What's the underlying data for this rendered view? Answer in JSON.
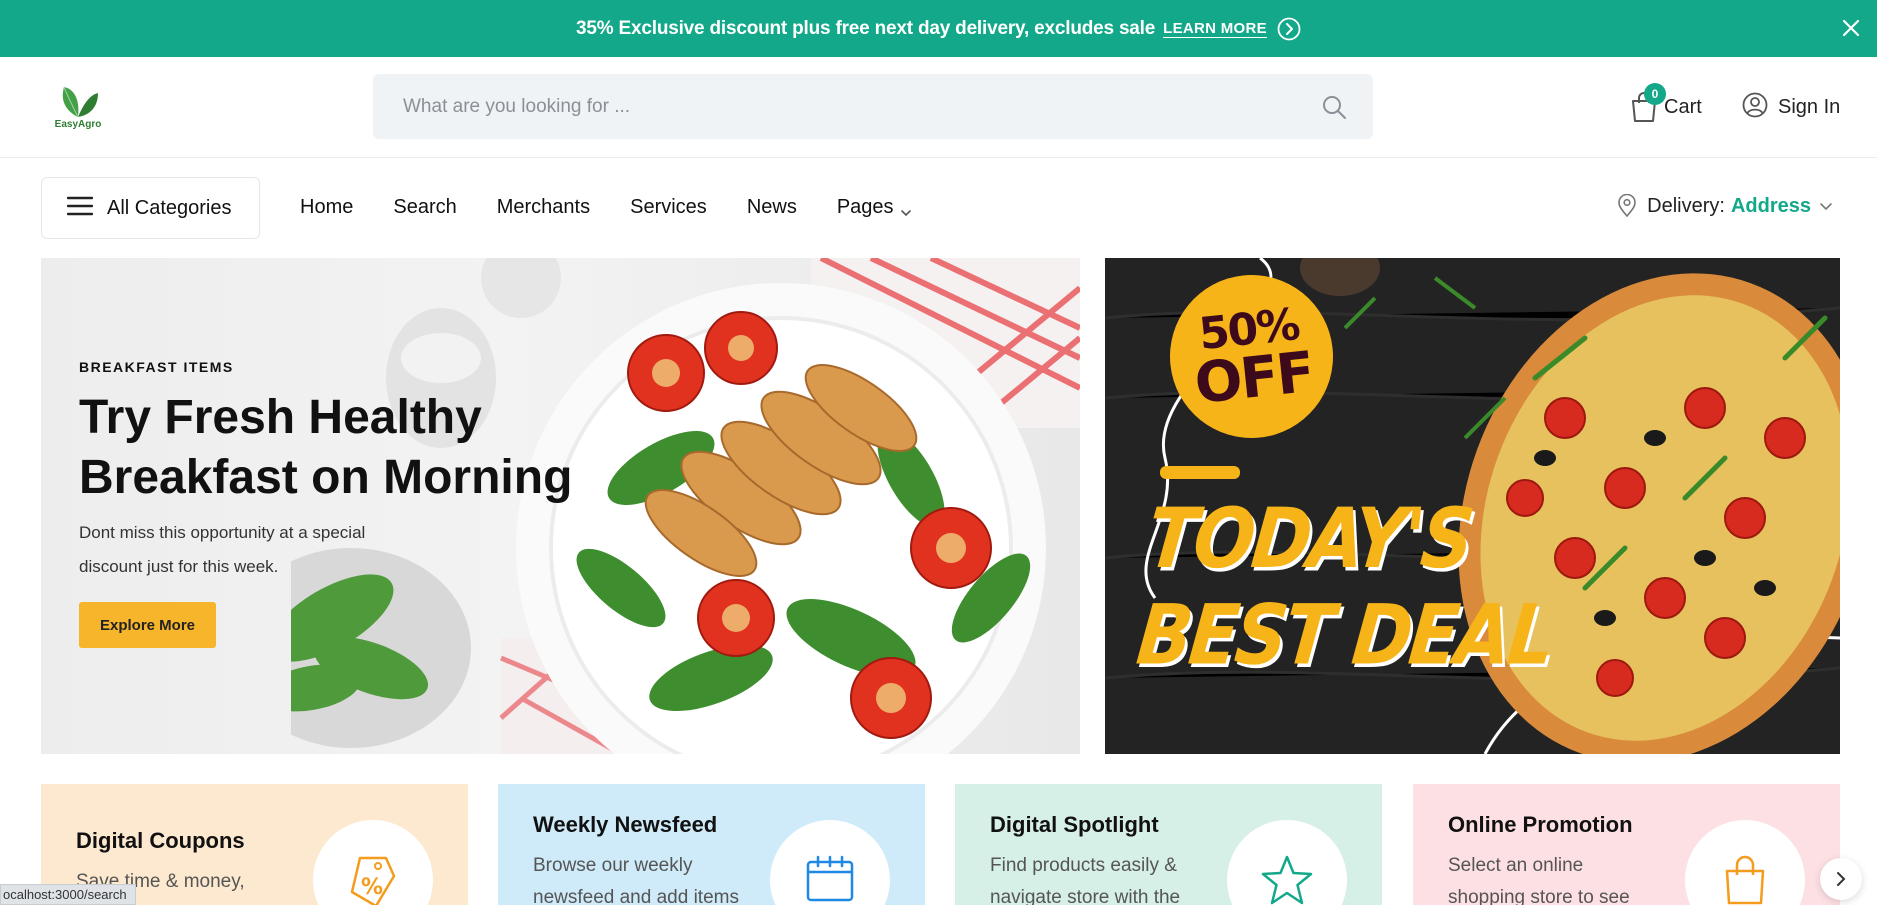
{
  "promo": {
    "message": "35% Exclusive discount plus free next day delivery, excludes sale",
    "link_label": "LEARN MORE"
  },
  "header": {
    "logo_text": "EasyAgro",
    "search_placeholder": "What are you looking for ...",
    "cart_label": "Cart",
    "cart_count": "0",
    "signin_label": "Sign In"
  },
  "nav": {
    "all_categories": "All Categories",
    "items": [
      {
        "label": "Home"
      },
      {
        "label": "Search"
      },
      {
        "label": "Merchants"
      },
      {
        "label": "Services"
      },
      {
        "label": "News"
      },
      {
        "label": "Pages"
      }
    ],
    "delivery_label": "Delivery:",
    "delivery_value": "Address"
  },
  "hero": {
    "kicker": "BREAKFAST ITEMS",
    "title": "Try Fresh Healthy Breakfast on Morning",
    "description": "Dont miss this opportunity at a special discount just for this week.",
    "button_label": "Explore More",
    "deal_percent": "50%",
    "deal_off": "OFF",
    "deal_line1": "TODAY'S",
    "deal_line2": "BEST DEAL"
  },
  "cards": [
    {
      "title": "Digital Coupons",
      "description": "Save time & money,",
      "icon": "tag-percent-icon"
    },
    {
      "title": "Weekly Newsfeed",
      "description": "Browse our weekly newsfeed and add items",
      "icon": "calendar-icon"
    },
    {
      "title": "Digital Spotlight",
      "description": "Find products easily & navigate store with the",
      "icon": "star-icon"
    },
    {
      "title": "Online Promotion",
      "description": "Select an online shopping store to see",
      "icon": "shopping-bag-icon"
    }
  ],
  "status_bar": "ocalhost:3000/search",
  "colors": {
    "brand": "#12a889",
    "accent": "#f6b52b"
  }
}
